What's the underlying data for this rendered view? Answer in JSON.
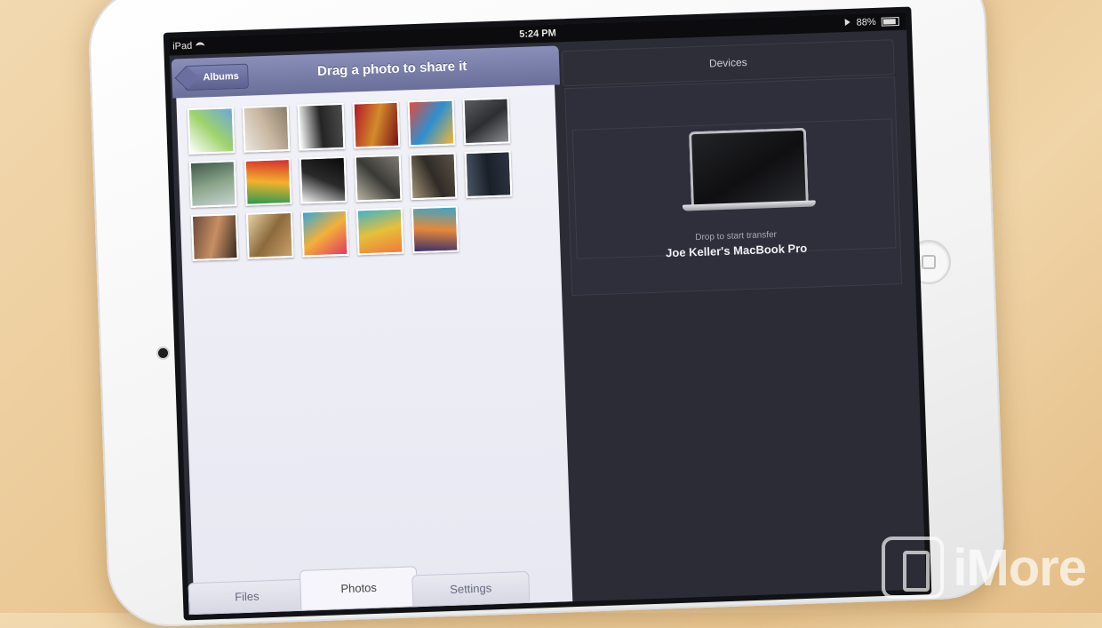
{
  "status_bar": {
    "device": "iPad",
    "time": "5:24 PM",
    "battery": "88%"
  },
  "left_panel": {
    "back_button_label": "Albums",
    "title": "Drag a photo to share it",
    "photos": [
      {
        "colors": [
          "#ffffff",
          "#9fd36a",
          "#6ba6dd"
        ]
      },
      {
        "colors": [
          "#e9e6df",
          "#c9b8a2",
          "#8a7d6b"
        ]
      },
      {
        "colors": [
          "#ffffff",
          "#242424",
          "#4c4c4c"
        ]
      },
      {
        "colors": [
          "#b2162a",
          "#d38b2a",
          "#7a0e17"
        ]
      },
      {
        "colors": [
          "#e24b3c",
          "#2e8fd0",
          "#f3b734"
        ]
      },
      {
        "colors": [
          "#5a5c61",
          "#2d2e31",
          "#8a8c90"
        ]
      },
      {
        "colors": [
          "#3d5a4a",
          "#8aa48a",
          "#c7d3d0"
        ]
      },
      {
        "colors": [
          "#d62d2d",
          "#f3b12d",
          "#2a9a52"
        ]
      },
      {
        "colors": [
          "#0b0b0b",
          "#2a2a2a",
          "#f0f0f0"
        ]
      },
      {
        "colors": [
          "#7d7a70",
          "#3a3a36",
          "#b8b3a3"
        ]
      },
      {
        "colors": [
          "#5a5246",
          "#2f2b26",
          "#a49478"
        ]
      },
      {
        "colors": [
          "#2c3442",
          "#1a2028",
          "#4a5565"
        ]
      },
      {
        "colors": [
          "#3a2a22",
          "#c78f64",
          "#6b4a3a"
        ]
      },
      {
        "colors": [
          "#c9a16b",
          "#8c6a3c",
          "#e6d1a6"
        ]
      },
      {
        "colors": [
          "#e03a62",
          "#f4b03a",
          "#35a7d9"
        ]
      },
      {
        "colors": [
          "#f07a3a",
          "#e5c03b",
          "#3fb3c7"
        ]
      },
      {
        "colors": [
          "#3a2f6b",
          "#e5883a",
          "#3aa6c7"
        ]
      }
    ],
    "tabs": [
      {
        "label": "Files",
        "active": false
      },
      {
        "label": "Photos",
        "active": true
      },
      {
        "label": "Settings",
        "active": false
      }
    ]
  },
  "devices": {
    "header": "Devices",
    "drop_hint": "Drop to start transfer",
    "device_name": "Joe Keller's MacBook Pro"
  },
  "watermark": {
    "text": "iMore"
  }
}
